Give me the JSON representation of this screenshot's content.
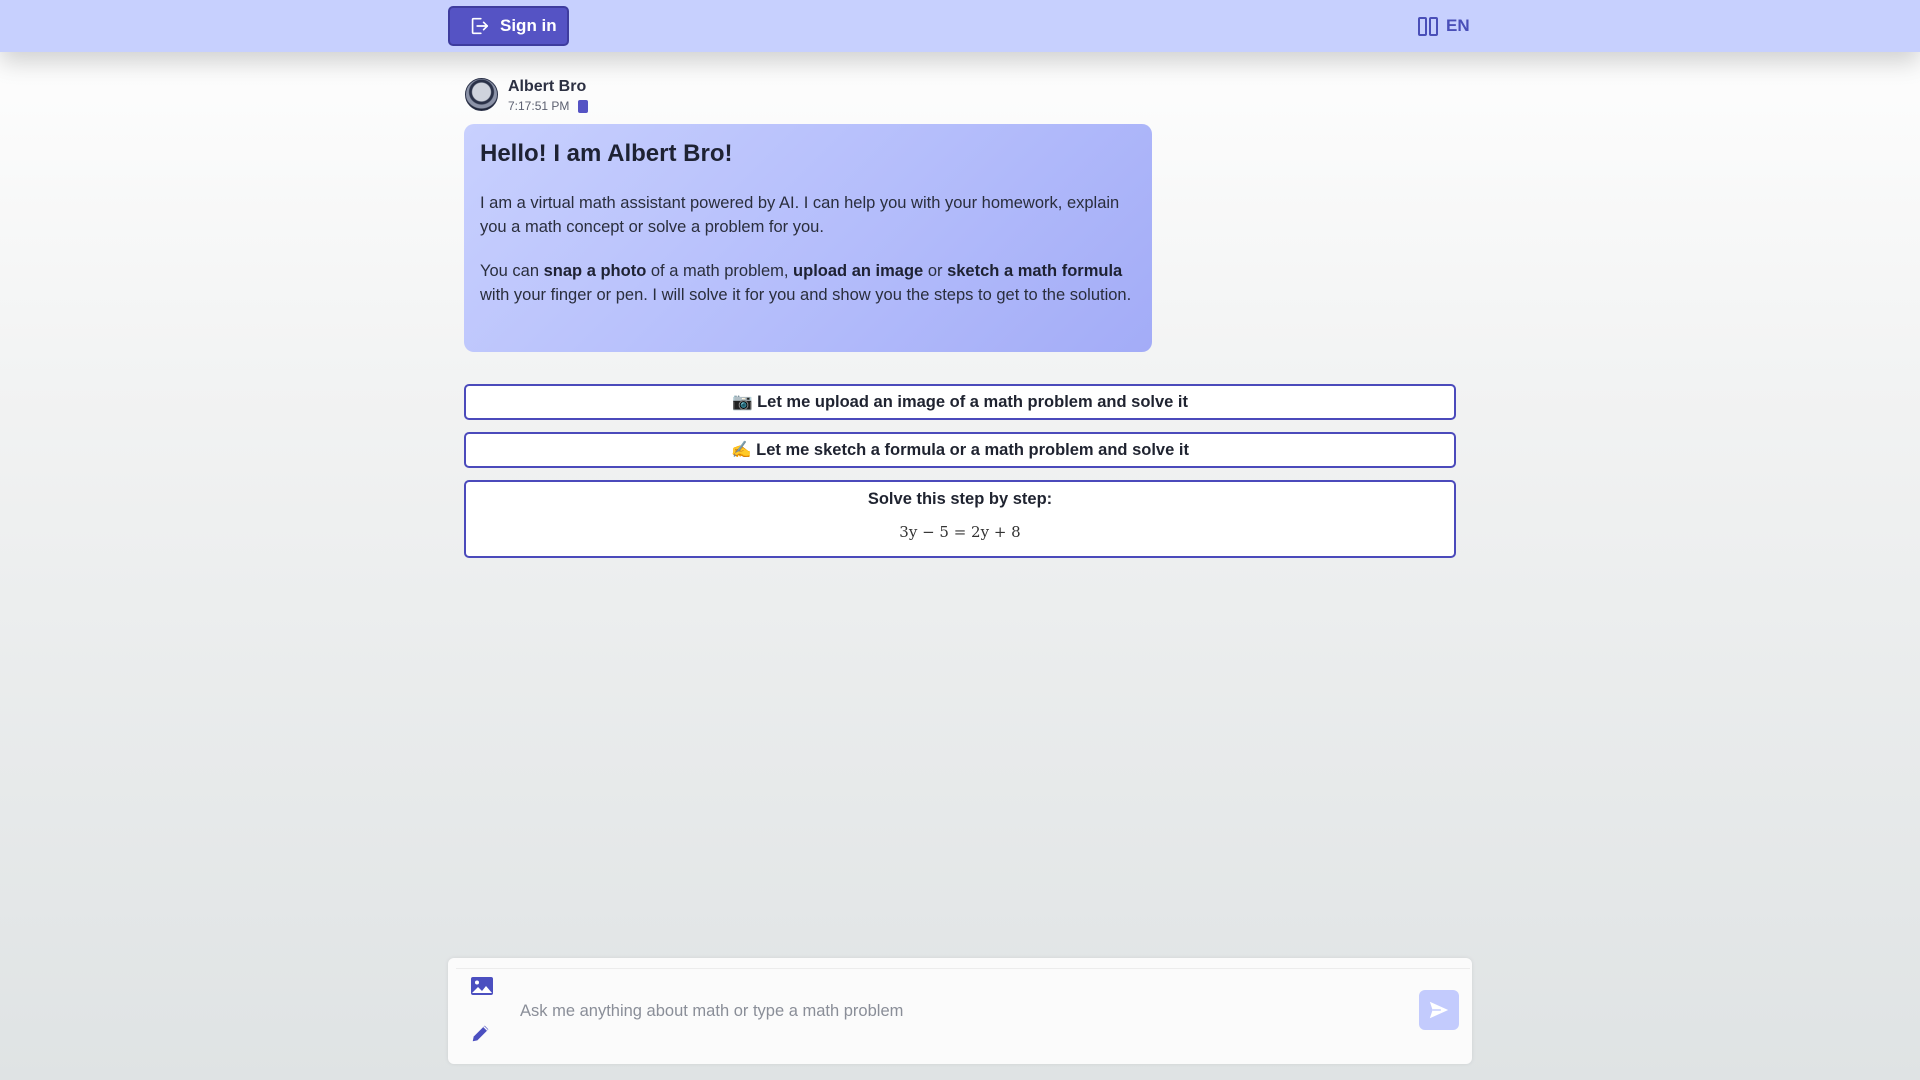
{
  "header": {
    "signin_label": "Sign in",
    "lang_label": "EN"
  },
  "message": {
    "author": "Albert Bro",
    "time": "7:17:51 PM",
    "title": "Hello! I am Albert Bro!",
    "para1": "I am a virtual math assistant powered by AI. I can help you with your homework, explain you a math concept or solve a problem for you.",
    "para2": {
      "t1": "You can ",
      "b1": "snap a photo",
      "t2": " of a math problem, ",
      "b2": "upload an image",
      "t3": " or ",
      "b3": "sketch a math formula",
      "t4": " with your finger or pen. I will solve it for you and show you the steps to get to the solution."
    }
  },
  "options": [
    {
      "label": "📷 Let me upload an image of a math problem and solve it"
    },
    {
      "label": "✍️ Let me sketch a formula or a math problem and solve it"
    },
    {
      "label": "Solve this step by step:",
      "equation": "3y − 5 = 2y + 8"
    }
  ],
  "composer": {
    "placeholder": "Ask me anything about math or type a math problem"
  },
  "colors": {
    "accent": "#5553c4",
    "topbar": "#c7d0fe",
    "bubble": "#b4bdfb"
  }
}
